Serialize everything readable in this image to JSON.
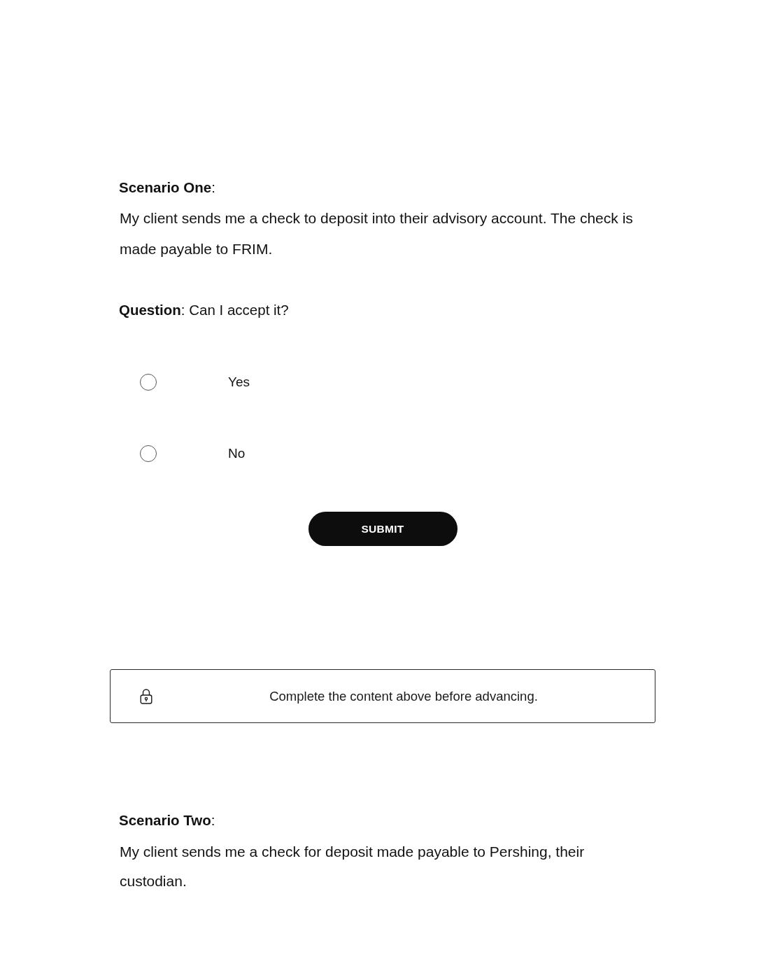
{
  "scenario_one": {
    "heading": "**Scenario One**:",
    "body": "My client sends me a check to deposit into their advisory account. The check is made payable to FRIM."
  },
  "question": {
    "prompt": "**Question**: Can I accept it?",
    "options": [
      {
        "label": "Yes",
        "selected": false
      },
      {
        "label": "No",
        "selected": false
      }
    ],
    "submit_button": "SUBMIT"
  },
  "notice": {
    "text": "Complete the content above before advancing."
  },
  "scenario_two": {
    "heading": "**Scenario Two**:",
    "body": "My client sends me a check for deposit made payable to Pershing, their custodian."
  }
}
